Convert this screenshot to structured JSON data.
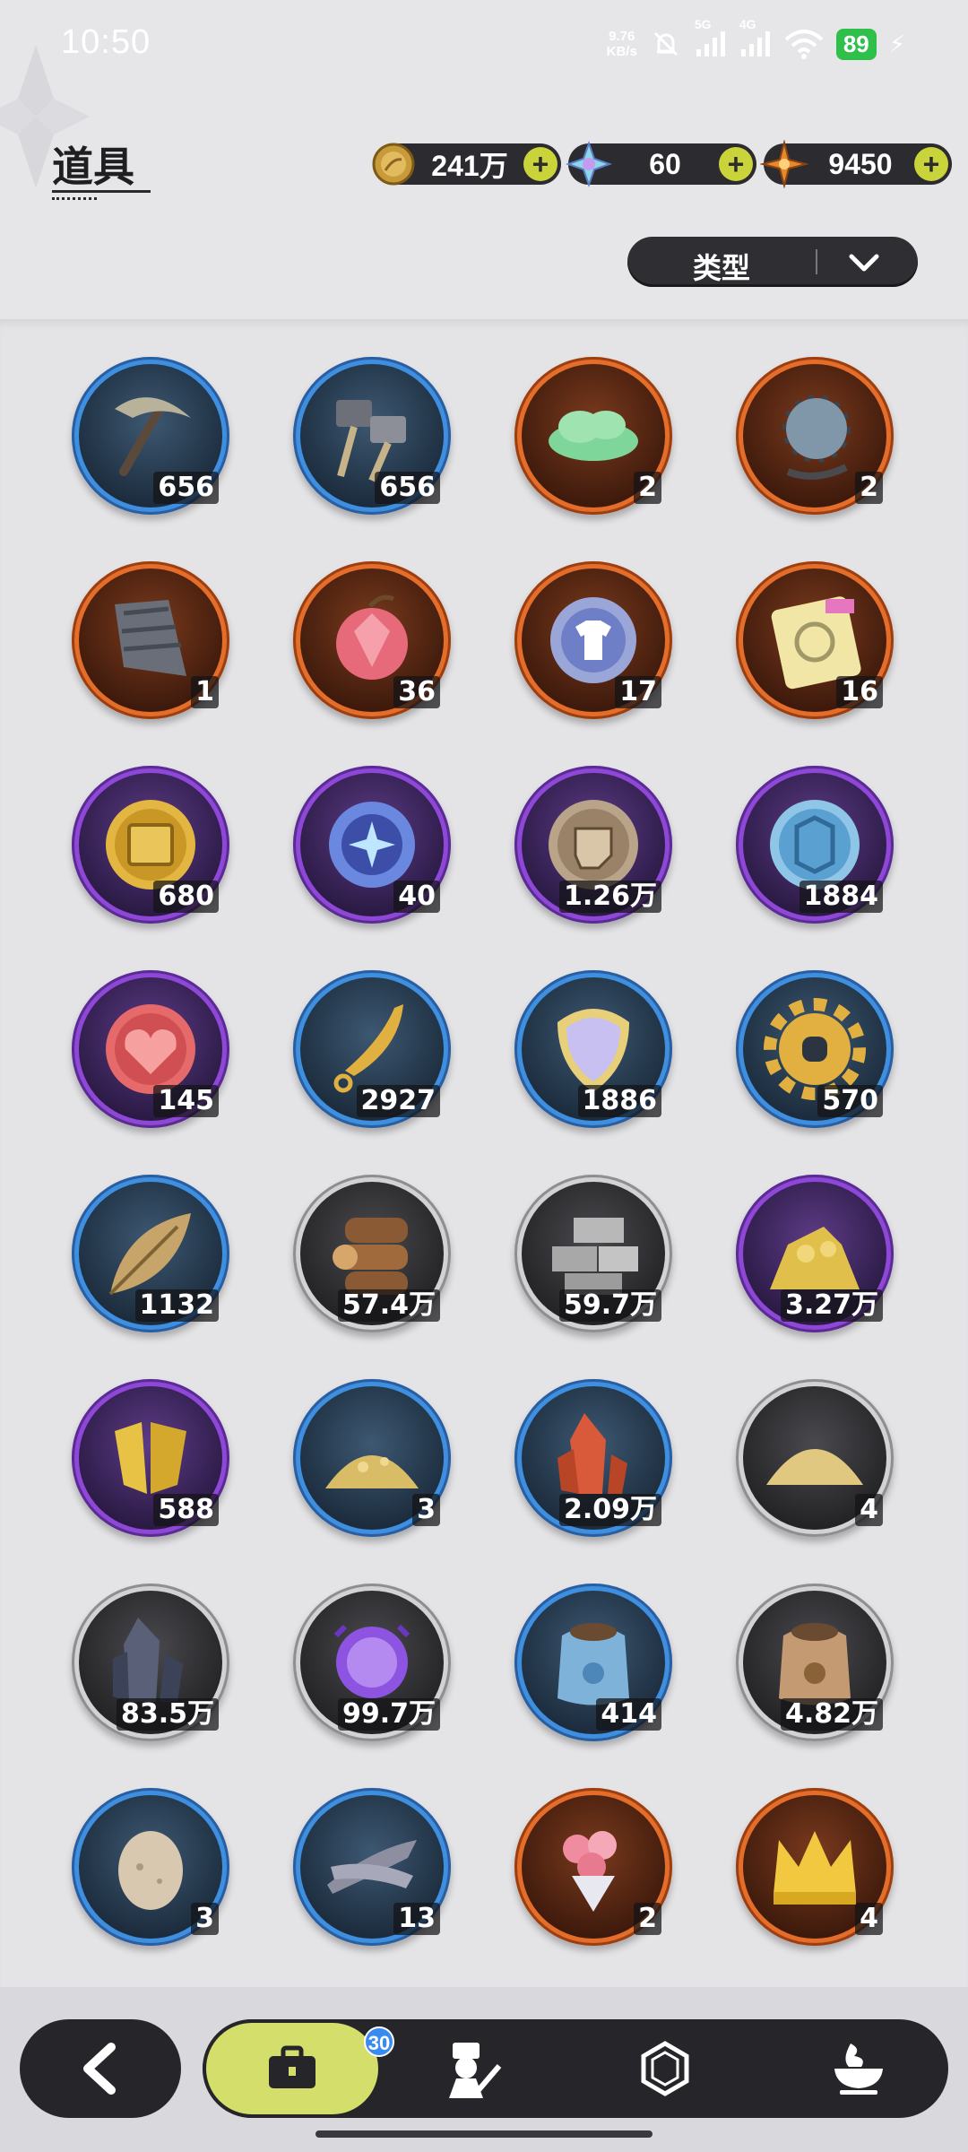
{
  "status_bar": {
    "time": "10:50",
    "net_speed_value": "9.76",
    "net_speed_unit": "KB/s",
    "network_5g": "5G",
    "network_4g": "4G",
    "battery": "89"
  },
  "header": {
    "title": "道具"
  },
  "currencies": [
    {
      "icon": "gold-coin-icon",
      "value": "241万"
    },
    {
      "icon": "crystal-star-icon",
      "value": "60"
    },
    {
      "icon": "orange-star-icon",
      "value": "9450"
    }
  ],
  "filter": {
    "label": "类型"
  },
  "items": [
    {
      "icon": "pickaxe-icon",
      "rarity": "blue",
      "count": "656"
    },
    {
      "icon": "hammer-icon",
      "rarity": "blue",
      "count": "656"
    },
    {
      "icon": "green-cloud-icon",
      "rarity": "orange",
      "count": "2"
    },
    {
      "icon": "spiked-ball-icon",
      "rarity": "orange",
      "count": "2"
    },
    {
      "icon": "drill-bit-icon",
      "rarity": "orange",
      "count": "1"
    },
    {
      "icon": "crystal-apple-icon",
      "rarity": "orange",
      "count": "36"
    },
    {
      "icon": "outfit-token-icon",
      "rarity": "orange",
      "count": "17"
    },
    {
      "icon": "puzzle-ticket-icon",
      "rarity": "orange",
      "count": "16"
    },
    {
      "icon": "gold-chest-coin-icon",
      "rarity": "purple",
      "count": "680"
    },
    {
      "icon": "star-orb-icon",
      "rarity": "purple",
      "count": "40"
    },
    {
      "icon": "fist-coin-icon",
      "rarity": "purple",
      "count": "1.26万"
    },
    {
      "icon": "blue-crest-coin-icon",
      "rarity": "purple",
      "count": "1884"
    },
    {
      "icon": "heart-coin-icon",
      "rarity": "purple",
      "count": "145"
    },
    {
      "icon": "golden-blade-icon",
      "rarity": "blue",
      "count": "2927"
    },
    {
      "icon": "scale-shield-icon",
      "rarity": "blue",
      "count": "1886"
    },
    {
      "icon": "gear-icon",
      "rarity": "blue",
      "count": "570"
    },
    {
      "icon": "leaf-icon",
      "rarity": "blue",
      "count": "1132"
    },
    {
      "icon": "wood-logs-icon",
      "rarity": "gray",
      "count": "57.4万"
    },
    {
      "icon": "stone-bricks-icon",
      "rarity": "gray",
      "count": "59.7万"
    },
    {
      "icon": "gold-nuggets-icon",
      "rarity": "purple",
      "count": "3.27万"
    },
    {
      "icon": "gold-crystal-icon",
      "rarity": "purple",
      "count": "588"
    },
    {
      "icon": "gold-dust-pile-icon",
      "rarity": "blue",
      "count": "3"
    },
    {
      "icon": "red-crystal-icon",
      "rarity": "blue",
      "count": "2.09万"
    },
    {
      "icon": "sand-pile-icon",
      "rarity": "gray",
      "count": "4"
    },
    {
      "icon": "dark-crystal-icon",
      "rarity": "gray",
      "count": "83.5万"
    },
    {
      "icon": "purple-orb-icon",
      "rarity": "gray",
      "count": "99.7万"
    },
    {
      "icon": "blue-pet-food-bag-icon",
      "rarity": "blue",
      "count": "414"
    },
    {
      "icon": "brown-pet-food-bag-icon",
      "rarity": "gray",
      "count": "4.82万"
    },
    {
      "icon": "egg-icon",
      "rarity": "blue",
      "count": "3"
    },
    {
      "icon": "feather-bundle-icon",
      "rarity": "blue",
      "count": "13"
    },
    {
      "icon": "flower-bouquet-icon",
      "rarity": "orange",
      "count": "2"
    },
    {
      "icon": "gold-crown-icon",
      "rarity": "orange",
      "count": "4"
    }
  ],
  "bottom_nav": {
    "badge": "30",
    "tabs": [
      "bag-icon",
      "character-icon",
      "hexagon-gem-icon",
      "cooking-pot-icon"
    ]
  }
}
